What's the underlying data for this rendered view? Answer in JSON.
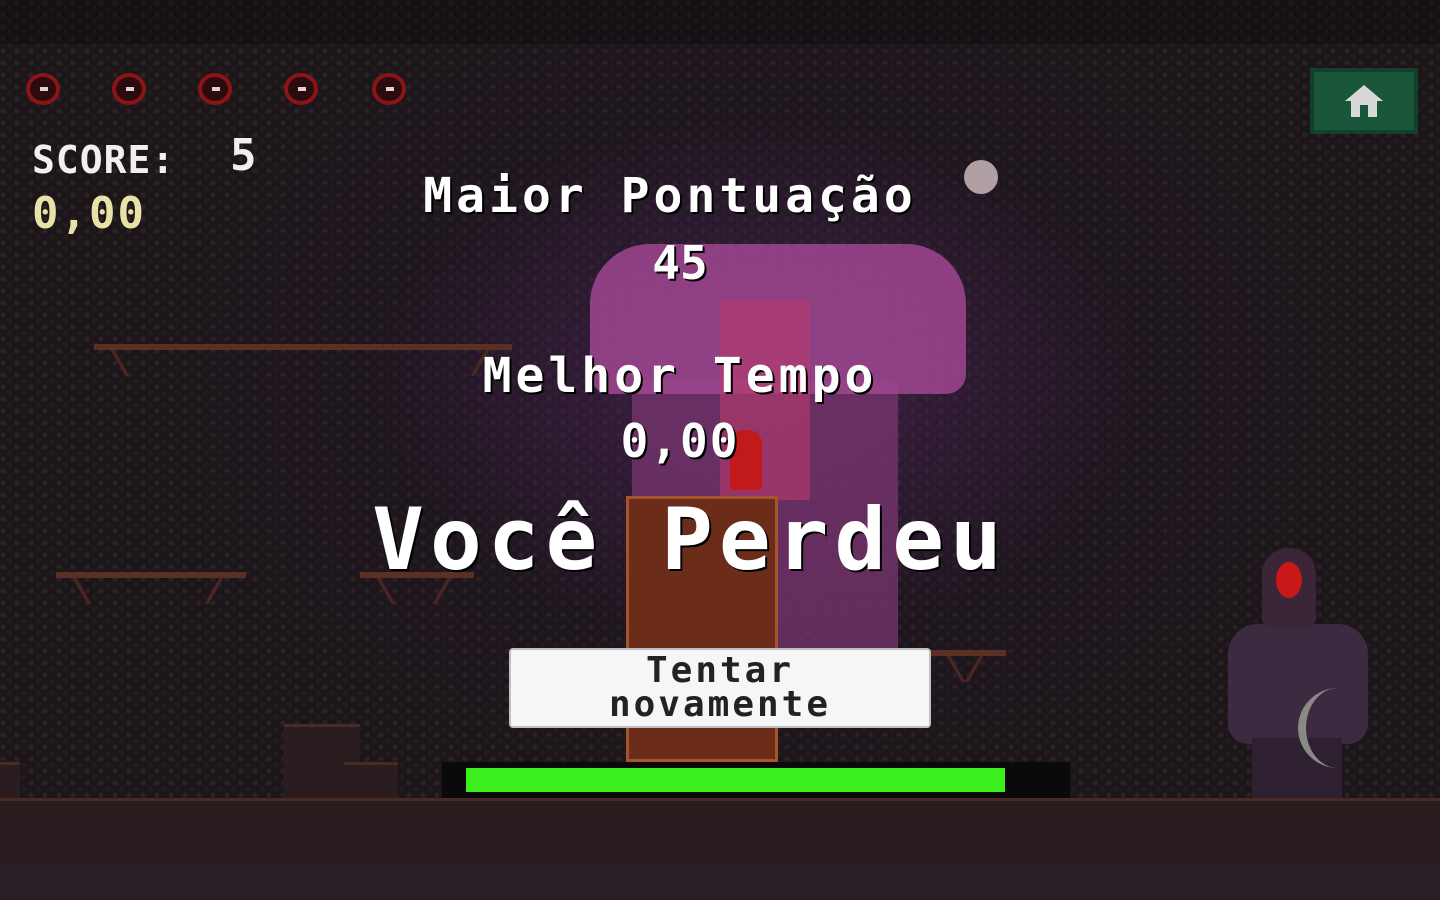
{
  "hud": {
    "lives": [
      1,
      1,
      1,
      1,
      1
    ],
    "score_label": "SCORE:",
    "score_value": "5",
    "time_value": "0,00",
    "home_icon": "home-icon",
    "home_color": "#19563a"
  },
  "game_over": {
    "high_score_title": "Maior Pontuação",
    "high_score_value": "45",
    "best_time_title": "Melhor Tempo",
    "best_time_value": "0,00",
    "title": "Você Perdeu",
    "retry_label": "Tentar\nnovamente"
  },
  "progress": {
    "fraction": 0.93,
    "color": "#3aef1c"
  }
}
